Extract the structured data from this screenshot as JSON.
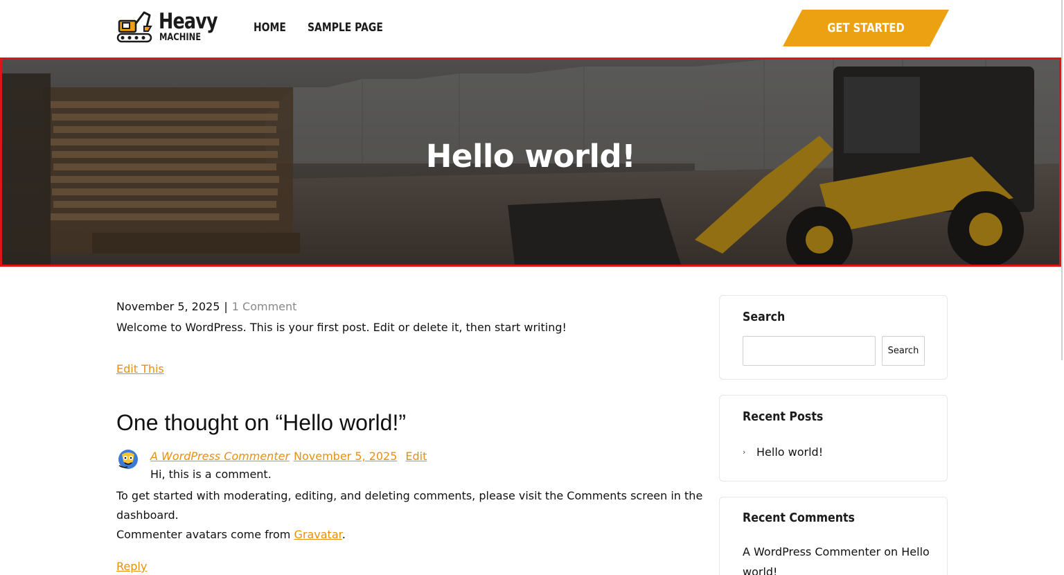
{
  "header": {
    "logo_title": "Heavy",
    "logo_subtitle": "MACHINE",
    "nav": [
      {
        "label": "HOME"
      },
      {
        "label": "SAMPLE PAGE"
      }
    ],
    "cta_label": "GET STARTED",
    "accent_color": "#eba112"
  },
  "hero": {
    "title": "Hello world!",
    "border_color": "#e11414"
  },
  "post": {
    "date": "November 5, 2025",
    "separator": "|",
    "comments_link": "1 Comment",
    "excerpt": "Welcome to WordPress. This is your first post. Edit or delete it, then start writing!",
    "edit_link": "Edit This"
  },
  "comments": {
    "heading": "One thought on “Hello world!”",
    "items": [
      {
        "author": "A WordPress Commenter",
        "date": "November 5, 2025",
        "edit": "Edit",
        "short_text": "Hi, this is a comment.",
        "body_line1": "To get started with moderating, editing, and deleting comments, please visit the Comments screen in the dashboard.",
        "body_line2_prefix": "Commenter avatars come from ",
        "body_line2_link": "Gravatar",
        "body_line2_suffix": ".",
        "reply": "Reply"
      }
    ]
  },
  "sidebar": {
    "search": {
      "title": "Search",
      "input_value": "",
      "button_label": "Search"
    },
    "recent_posts": {
      "title": "Recent Posts",
      "items": [
        {
          "label": "Hello world!",
          "icon": "chevron-right-icon"
        }
      ]
    },
    "recent_comments": {
      "title": "Recent Comments",
      "items": [
        {
          "text": "A WordPress Commenter on Hello world!"
        }
      ]
    }
  },
  "colors": {
    "link": "#e8900c",
    "text": "#111111",
    "muted": "#888888"
  }
}
